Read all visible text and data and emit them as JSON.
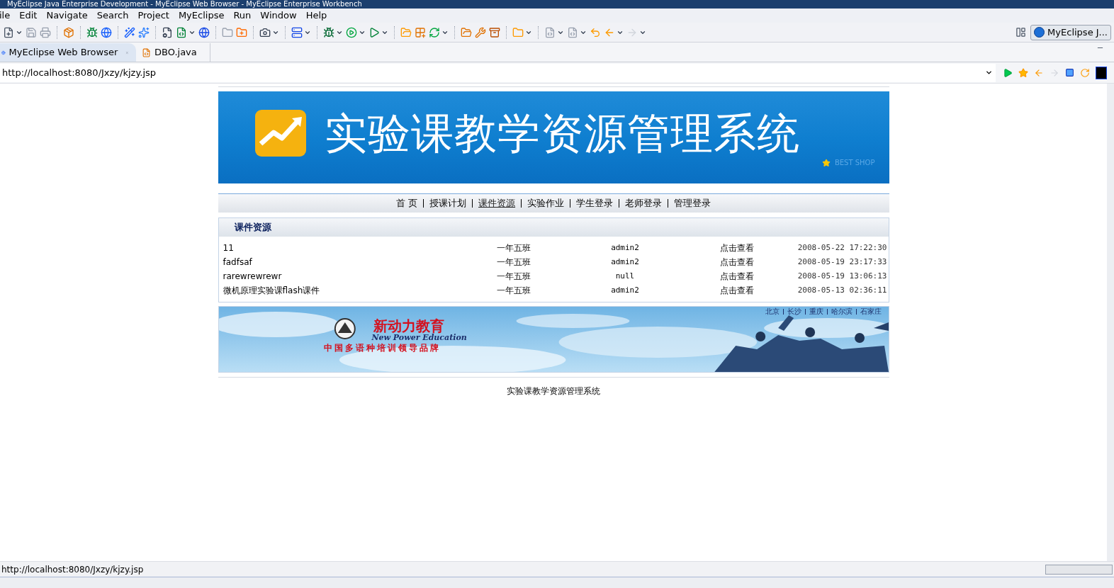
{
  "window": {
    "title": "MyEclipse Java Enterprise Development - MyEclipse Web Browser - MyEclipse Enterprise Workbench"
  },
  "menu": [
    "ile",
    "Edit",
    "Navigate",
    "Search",
    "Project",
    "MyEclipse",
    "Run",
    "Window",
    "Help"
  ],
  "perspective": {
    "label": "MyEclipse J..."
  },
  "editor_tabs": [
    {
      "label": "MyEclipse Web Browser",
      "selected": true
    },
    {
      "label": "DBO.java",
      "selected": false
    }
  ],
  "address_bar": {
    "value": "http://localhost:8080/Jxzy/kjzy.jsp"
  },
  "page": {
    "banner": {
      "title": "实验课教学资源管理系统",
      "tagline": "BEST SHOP"
    },
    "nav": [
      {
        "label": "首 页",
        "selected": false
      },
      {
        "label": "授课计划",
        "selected": false
      },
      {
        "label": "课件资源",
        "selected": true
      },
      {
        "label": "实验作业",
        "selected": false
      },
      {
        "label": "学生登录",
        "selected": false
      },
      {
        "label": "老师登录",
        "selected": false
      },
      {
        "label": "管理登录",
        "selected": false
      }
    ],
    "section": {
      "title": "课件资源",
      "rows": [
        [
          "11",
          "一年五班",
          "admin2",
          "点击查看",
          "2008-05-22 17:22:30"
        ],
        [
          "fadfsaf",
          "一年五班",
          "admin2",
          "点击查看",
          "2008-05-19 23:17:33"
        ],
        [
          "rarewrewrewr",
          "一年五班",
          "null",
          "点击查看",
          "2008-05-19 13:06:13"
        ],
        [
          "微机原理实验课flash课件",
          "一年五班",
          "admin2",
          "点击查看",
          "2008-05-13 02:36:11"
        ]
      ]
    },
    "ad": {
      "brand": "新动力教育",
      "brand_en": "New Power Education",
      "slogan": "中国多语种培训领导品牌",
      "cities": [
        "北京",
        "长沙",
        "重庆",
        "哈尔滨",
        "石家庄"
      ]
    },
    "footer": "实验课教学资源管理系统"
  },
  "status_bar": {
    "text": "http://localhost:8080/Jxzy/kjzy.jsp"
  }
}
